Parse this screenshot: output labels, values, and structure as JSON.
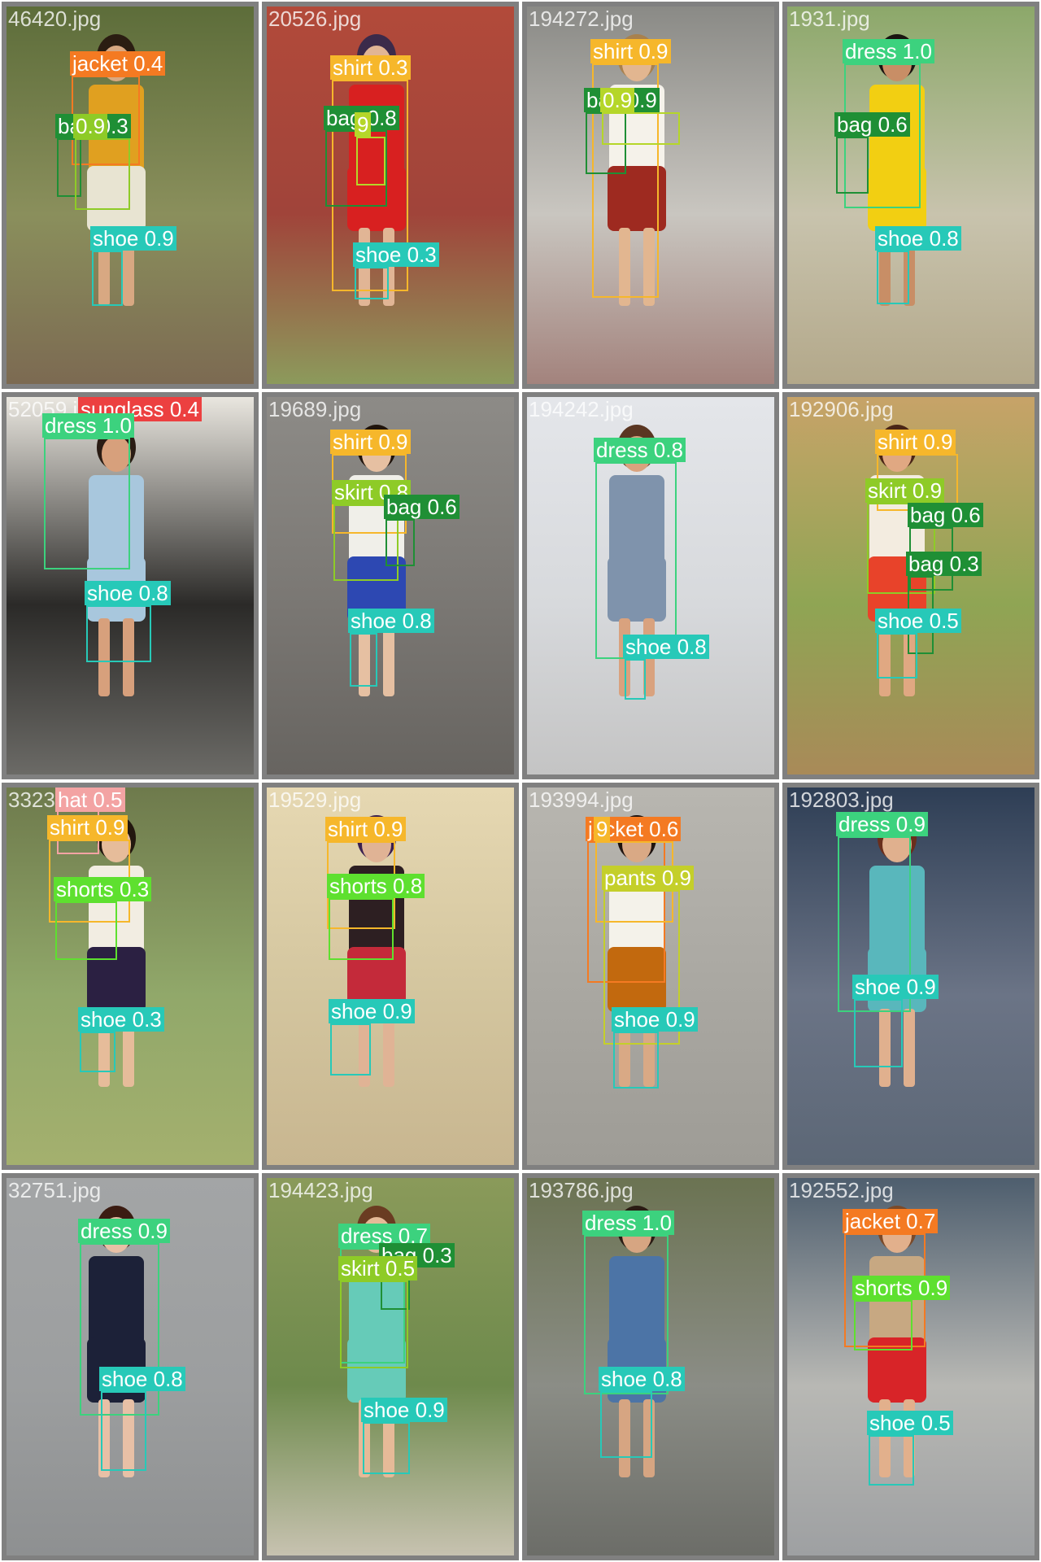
{
  "colors": {
    "jacket": "#f47a22",
    "shirt": "#f6b72b",
    "bag": "#1f8f35",
    "shoe": "#27c9b8",
    "dress": "#3cd27e",
    "skirt": "#8ecb27",
    "shorts": "#5ee02f",
    "pants": "#c4cf2a",
    "sunglass": "#ec4040",
    "hat": "#f3a3a3",
    "other": "#b5d629"
  },
  "cells": [
    {
      "filename": "46420.jpg",
      "scene": [
        "#5d6d3a",
        "#8a8f5c",
        "#7c6a52"
      ],
      "person": {
        "skin": "#d8a882",
        "top": "#e0a020",
        "bottom": "#e8e4d2",
        "hair": "#2b1d12"
      },
      "detections": [
        {
          "label": "jacket 0.4",
          "cls": "jacket"
        },
        {
          "label": "bag 0.3",
          "cls": "bag"
        },
        {
          "label": "0.9",
          "cls": "skirt"
        },
        {
          "label": "shoe 0.9",
          "cls": "shoe"
        }
      ]
    },
    {
      "filename": "20526.jpg",
      "scene": [
        "#b24a3a",
        "#a0443a",
        "#8c9a5c"
      ],
      "person": {
        "skin": "#e1b595",
        "top": "#d82020",
        "bottom": "#d82020",
        "hair": "#3b2a4a"
      },
      "detections": [
        {
          "label": "shirt 0.3",
          "cls": "shirt"
        },
        {
          "label": "bag 0.8",
          "cls": "bag"
        },
        {
          "label": "9",
          "cls": "other"
        },
        {
          "label": "shoe 0.3",
          "cls": "shoe"
        }
      ]
    },
    {
      "filename": "194272.jpg",
      "scene": [
        "#8a8a86",
        "#c9c6c0",
        "#a3837d"
      ],
      "person": {
        "skin": "#e2b690",
        "top": "#f5f2ea",
        "bottom": "#9e2a20",
        "hair": "#a8814e"
      },
      "detections": [
        {
          "label": "shirt 0.9",
          "cls": "shirt"
        },
        {
          "label": "bag 0.9",
          "cls": "bag"
        },
        {
          "label": "0.9",
          "cls": "other"
        }
      ]
    },
    {
      "filename": "1931.jpg",
      "scene": [
        "#8ca86a",
        "#c8c3ad",
        "#b3a88a"
      ],
      "person": {
        "skin": "#c88e66",
        "top": "#f2cf12",
        "bottom": "#f2cf12",
        "hair": "#1a1410"
      },
      "detections": [
        {
          "label": "dress 1.0",
          "cls": "dress"
        },
        {
          "label": "bag 0.6",
          "cls": "bag"
        },
        {
          "label": "shoe 0.8",
          "cls": "shoe"
        }
      ]
    },
    {
      "filename": "52059.jpg",
      "scene": [
        "#e9e6df",
        "#2b2a28",
        "#6b6a66"
      ],
      "person": {
        "skin": "#d7a07c",
        "top": "#a8c7dd",
        "bottom": "#a8c7dd",
        "hair": "#2a1c14"
      },
      "detections": [
        {
          "label": "sunglass 0.4",
          "cls": "sunglass"
        },
        {
          "label": "dress 1.0",
          "cls": "dress"
        },
        {
          "label": "shoe 0.8",
          "cls": "shoe"
        }
      ]
    },
    {
      "filename": "19689.jpg",
      "scene": [
        "#8d8b87",
        "#7a7773",
        "#676460"
      ],
      "person": {
        "skin": "#e6c0a2",
        "top": "#f0efe9",
        "bottom": "#2d48b2",
        "hair": "#20140c"
      },
      "detections": [
        {
          "label": "shirt 0.9",
          "cls": "shirt"
        },
        {
          "label": "skirt 0.8",
          "cls": "skirt"
        },
        {
          "label": "bag 0.6",
          "cls": "bag"
        },
        {
          "label": "shoe 0.8",
          "cls": "shoe"
        }
      ]
    },
    {
      "filename": "194242.jpg",
      "scene": [
        "#e4e6ea",
        "#d7d9dc",
        "#c4c4c4"
      ],
      "person": {
        "skin": "#d9a27e",
        "top": "#7f93ac",
        "bottom": "#7f93ac",
        "hair": "#5a3622"
      },
      "detections": [
        {
          "label": "dress 0.8",
          "cls": "dress"
        },
        {
          "label": "shoe 0.8",
          "cls": "shoe"
        }
      ]
    },
    {
      "filename": "192906.jpg",
      "scene": [
        "#c7a368",
        "#8fa554",
        "#a98a58"
      ],
      "person": {
        "skin": "#e0a882",
        "top": "#f3ece0",
        "bottom": "#e8432a",
        "hair": "#4a2616"
      },
      "detections": [
        {
          "label": "shirt 0.9",
          "cls": "shirt"
        },
        {
          "label": "skirt 0.9",
          "cls": "skirt"
        },
        {
          "label": "bag 0.6",
          "cls": "bag"
        },
        {
          "label": "bag 0.3",
          "cls": "bag"
        },
        {
          "label": "shoe 0.5",
          "cls": "shoe"
        }
      ]
    },
    {
      "filename": "33231.jpg",
      "scene": [
        "#6e7a4c",
        "#91a86a",
        "#a4b06e"
      ],
      "person": {
        "skin": "#e6bc9a",
        "top": "#f2ede2",
        "bottom": "#2b2042",
        "hair": "#23170f"
      },
      "detections": [
        {
          "label": "hat 0.5",
          "cls": "hat"
        },
        {
          "label": "shirt 0.9",
          "cls": "shirt"
        },
        {
          "label": "shorts 0.3",
          "cls": "shorts"
        },
        {
          "label": "shoe 0.3",
          "cls": "shoe"
        }
      ]
    },
    {
      "filename": "19529.jpg",
      "scene": [
        "#e6d8b2",
        "#d3c59e",
        "#c8b690"
      ],
      "person": {
        "skin": "#e0b395",
        "top": "#2d1f22",
        "bottom": "#c42a3a",
        "hair": "#3a2050"
      },
      "detections": [
        {
          "label": "shirt 0.9",
          "cls": "shirt"
        },
        {
          "label": "shorts 0.8",
          "cls": "shorts"
        },
        {
          "label": "shoe 0.9",
          "cls": "shoe"
        }
      ]
    },
    {
      "filename": "193994.jpg",
      "scene": [
        "#b8b6b0",
        "#a9a7a1",
        "#9e9c96"
      ],
      "person": {
        "skin": "#d9a985",
        "top": "#f4f2ea",
        "bottom": "#c2690e",
        "hair": "#1f1410"
      },
      "detections": [
        {
          "label": "jacket 0.6",
          "cls": "jacket"
        },
        {
          "label": "9",
          "cls": "shirt"
        },
        {
          "label": "pants 0.9",
          "cls": "pants"
        },
        {
          "label": "shoe 0.9",
          "cls": "shoe"
        }
      ]
    },
    {
      "filename": "192803.jpg",
      "scene": [
        "#2e3e55",
        "#6b7486",
        "#5c6776"
      ],
      "person": {
        "skin": "#e0b08e",
        "top": "#59b7bc",
        "bottom": "#59b7bc",
        "hair": "#6a2e1c"
      },
      "detections": [
        {
          "label": "dress 0.9",
          "cls": "dress"
        },
        {
          "label": "shoe 0.9",
          "cls": "shoe"
        }
      ]
    },
    {
      "filename": "32751.jpg",
      "scene": [
        "#a3a5a6",
        "#9c9e9f",
        "#8e9091"
      ],
      "person": {
        "skin": "#e8c0a6",
        "top": "#1c2138",
        "bottom": "#1c2138",
        "hair": "#3b1c12"
      },
      "detections": [
        {
          "label": "dress 0.9",
          "cls": "dress"
        },
        {
          "label": "shoe 0.8",
          "cls": "shoe"
        }
      ]
    },
    {
      "filename": "194423.jpg",
      "scene": [
        "#8a9a5a",
        "#6e8a4c",
        "#c7c2b0"
      ],
      "person": {
        "skin": "#e6ba98",
        "top": "#66cbb8",
        "bottom": "#66cbb8",
        "hair": "#6a3c22"
      },
      "detections": [
        {
          "label": "dress 0.7",
          "cls": "dress"
        },
        {
          "label": "bag 0.3",
          "cls": "bag"
        },
        {
          "label": "skirt 0.5",
          "cls": "skirt"
        },
        {
          "label": "shoe 0.9",
          "cls": "shoe"
        }
      ]
    },
    {
      "filename": "193786.jpg",
      "scene": [
        "#6b7352",
        "#8b8d86",
        "#6c6d68"
      ],
      "person": {
        "skin": "#d6a582",
        "top": "#4c74a6",
        "bottom": "#4c74a6",
        "hair": "#2a1c14"
      },
      "detections": [
        {
          "label": "dress 1.0",
          "cls": "dress"
        },
        {
          "label": "shoe 0.8",
          "cls": "shoe"
        }
      ]
    },
    {
      "filename": "192552.jpg",
      "scene": [
        "#4e5e6e",
        "#b8b8b4",
        "#9ea0a2"
      ],
      "person": {
        "skin": "#e2b08c",
        "top": "#c7a882",
        "bottom": "#d82428",
        "hair": "#7a4a2a"
      },
      "detections": [
        {
          "label": "jacket 0.7",
          "cls": "jacket"
        },
        {
          "label": "shorts 0.9",
          "cls": "shorts"
        },
        {
          "label": "shoe 0.5",
          "cls": "shoe"
        }
      ]
    }
  ]
}
